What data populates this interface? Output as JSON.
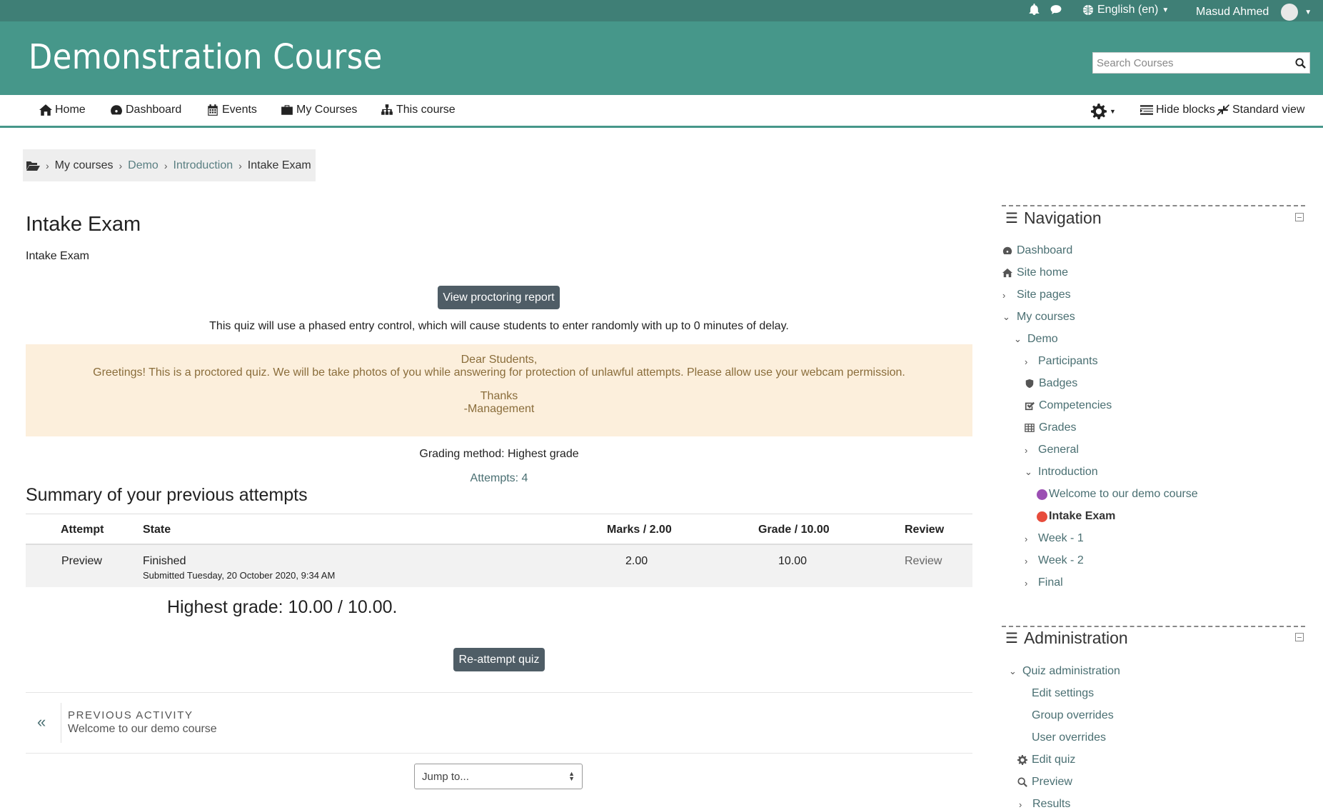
{
  "topbar": {
    "language": "English (en)",
    "user_name": "Masud Ahmed"
  },
  "header": {
    "course_title": "Demonstration Course",
    "search_placeholder": "Search Courses"
  },
  "navbar": {
    "items": [
      "Home",
      "Dashboard",
      "Events",
      "My Courses",
      "This course"
    ],
    "hide_blocks": "Hide blocks",
    "standard_view": "Standard view"
  },
  "breadcrumb": [
    "My courses",
    "Demo",
    "Introduction",
    "Intake Exam"
  ],
  "main": {
    "title": "Intake Exam",
    "intro": "Intake Exam",
    "proctoring_button": "View proctoring report",
    "phased_entry_text": "This quiz will use a phased entry control, which will cause students to enter randomly with up to 0 minutes of delay.",
    "notice": {
      "line1": "Dear Students,",
      "line2": "Greetings! This is a proctored quiz. We will be take photos of you while answering for protection of unlawful attempts. Please allow use your webcam permission.",
      "line3": "Thanks",
      "line4": "-Management"
    },
    "grading_method": "Grading method: Highest grade",
    "attempts_link": "Attempts: 4",
    "summary_heading": "Summary of your previous attempts",
    "table": {
      "headers": [
        "Attempt",
        "State",
        "Marks / 2.00",
        "Grade / 10.00",
        "Review"
      ],
      "row": {
        "attempt": "Preview",
        "state": "Finished",
        "submitted": "Submitted Tuesday, 20 October 2020, 9:34 AM",
        "marks": "2.00",
        "grade": "10.00",
        "review": "Review"
      }
    },
    "highest_grade": "Highest grade: 10.00 / 10.00.",
    "reattempt_button": "Re-attempt quiz",
    "previous_activity_label": "PREVIOUS ACTIVITY",
    "previous_activity_name": "Welcome to our demo course",
    "jump_to": "Jump to..."
  },
  "navigation_block": {
    "title": "Navigation",
    "items": [
      "Dashboard",
      "Site home",
      "Site pages",
      "My courses",
      "Demo",
      "Participants",
      "Badges",
      "Competencies",
      "Grades",
      "General",
      "Introduction",
      "Welcome to our demo course",
      "Intake Exam",
      "Week - 1",
      "Week - 2",
      "Final"
    ]
  },
  "administration_block": {
    "title": "Administration",
    "items": [
      "Quiz administration",
      "Edit settings",
      "Group overrides",
      "User overrides",
      "Edit quiz",
      "Preview",
      "Results"
    ]
  },
  "colors": {
    "brand": "#46978a",
    "topbar": "#3f7f76",
    "button": "#4f5d66",
    "notice_bg": "#fcefdc",
    "notice_text": "#8a6d3b",
    "link": "#4a6f72"
  }
}
